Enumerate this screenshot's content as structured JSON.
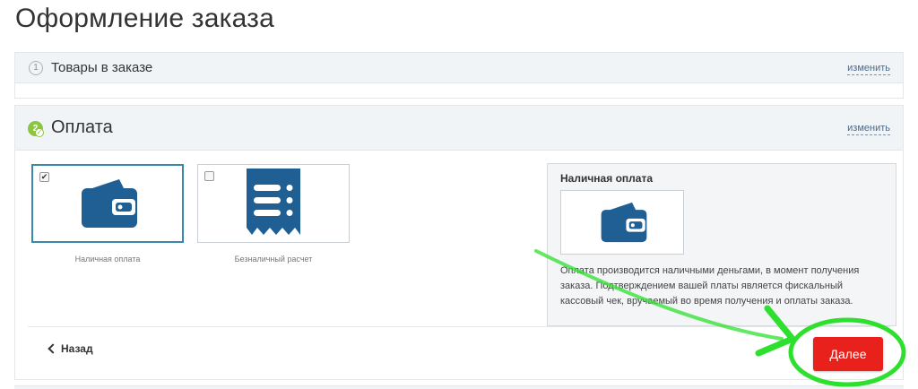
{
  "page_title": "Оформление заказа",
  "steps": [
    {
      "number": "1",
      "title": "Товары в заказе",
      "edit_label": "изменить"
    },
    {
      "number": "2",
      "title": "Оплата",
      "edit_label": "изменить"
    }
  ],
  "payment_methods": [
    {
      "label": "Наличная оплата",
      "selected": true,
      "icon": "wallet-icon"
    },
    {
      "label": "Безналичный расчет",
      "selected": false,
      "icon": "receipt-icon"
    }
  ],
  "payment_info": {
    "title": "Наличная оплата",
    "description": "Оплата производится наличными деньгами, в момент получения заказа. Подтверждением вашей платы является фискальный кассовый чек, вручаемый во время получения и оплаты заказа."
  },
  "nav": {
    "back_label": "Назад",
    "next_label": "Далее"
  },
  "colors": {
    "accent_blue": "#1f5f93",
    "selected_border": "#3a88aa",
    "next_button": "#e8211d",
    "done_green": "#8cc63f",
    "annotation_green": "#2ee02e"
  }
}
